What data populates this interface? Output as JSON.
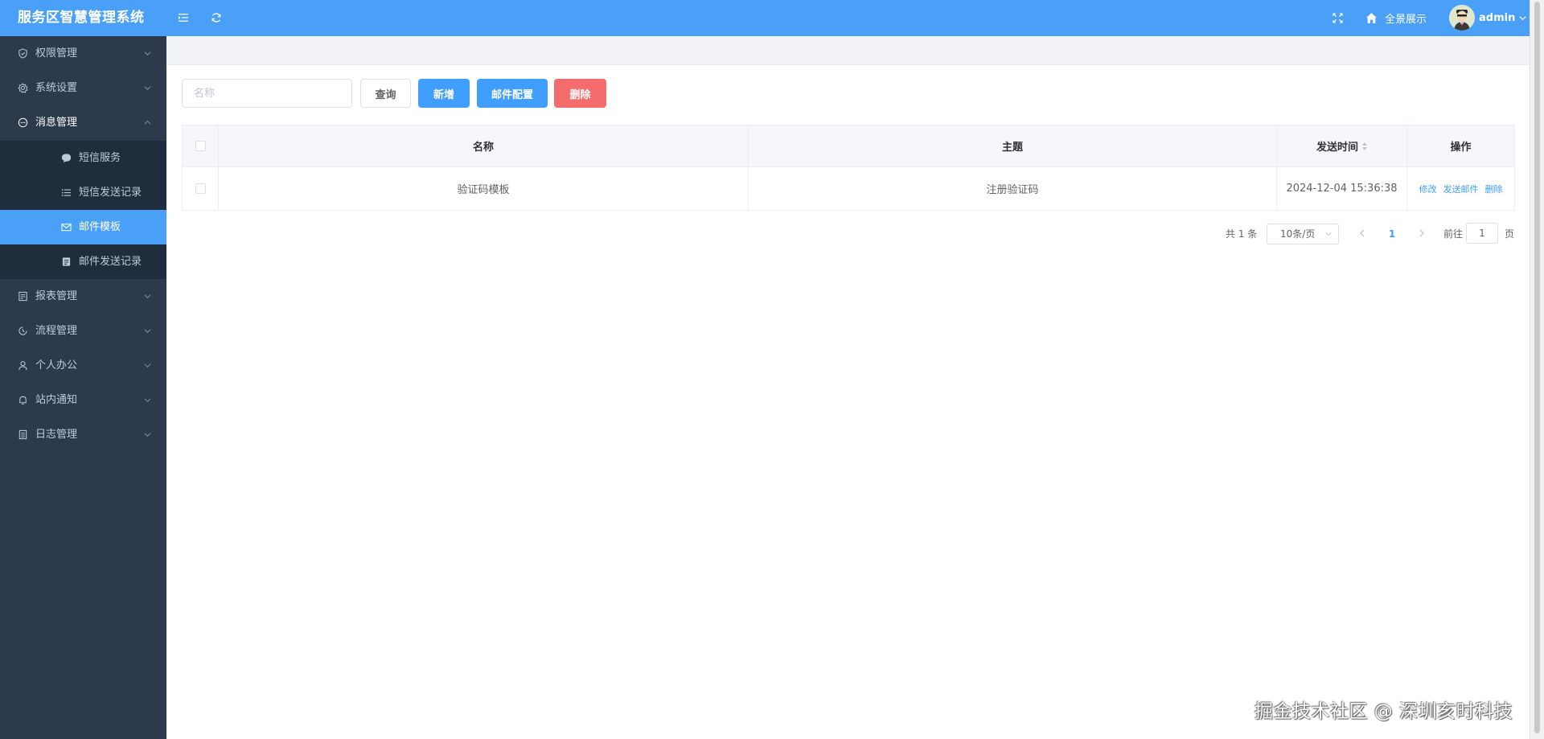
{
  "header": {
    "app_title": "服务区智慧管理系统",
    "portal_label": "全景展示",
    "username": "admin",
    "bg_color": "#4aa0f7"
  },
  "sidebar": {
    "items": [
      {
        "label": "权限管理",
        "icon": "shield-icon"
      },
      {
        "label": "系统设置",
        "icon": "gear-icon"
      },
      {
        "label": "消息管理",
        "icon": "chat-icon",
        "expanded": true
      },
      {
        "label": "报表管理",
        "icon": "report-icon"
      },
      {
        "label": "流程管理",
        "icon": "flow-icon"
      },
      {
        "label": "个人办公",
        "icon": "user-icon"
      },
      {
        "label": "站内通知",
        "icon": "bell-icon"
      },
      {
        "label": "日志管理",
        "icon": "log-icon"
      }
    ],
    "message_children": [
      {
        "label": "短信服务",
        "icon": "sms-icon"
      },
      {
        "label": "短信发送记录",
        "icon": "list-icon"
      },
      {
        "label": "邮件模板",
        "icon": "mail-icon",
        "active": true
      },
      {
        "label": "邮件发送记录",
        "icon": "record-icon"
      }
    ]
  },
  "toolbar": {
    "name_placeholder": "名称",
    "query_label": "查询",
    "add_label": "新增",
    "mail_config_label": "邮件配置",
    "delete_label": "删除"
  },
  "table": {
    "columns": [
      "名称",
      "主题",
      "发送时间",
      "操作"
    ],
    "rows": [
      {
        "name": "验证码模板",
        "subject": "注册验证码",
        "send_time": "2024-12-04 15:36:38",
        "ops": [
          "修改",
          "发送邮件",
          "删除"
        ]
      }
    ]
  },
  "pagination": {
    "total_label": "共 1 条",
    "page_size_label": "10条/页",
    "current_page": "1",
    "goto_label": "前往",
    "goto_value": "1",
    "page_suffix": "页"
  },
  "watermark": "掘金技术社区 @ 深圳亥时科技"
}
